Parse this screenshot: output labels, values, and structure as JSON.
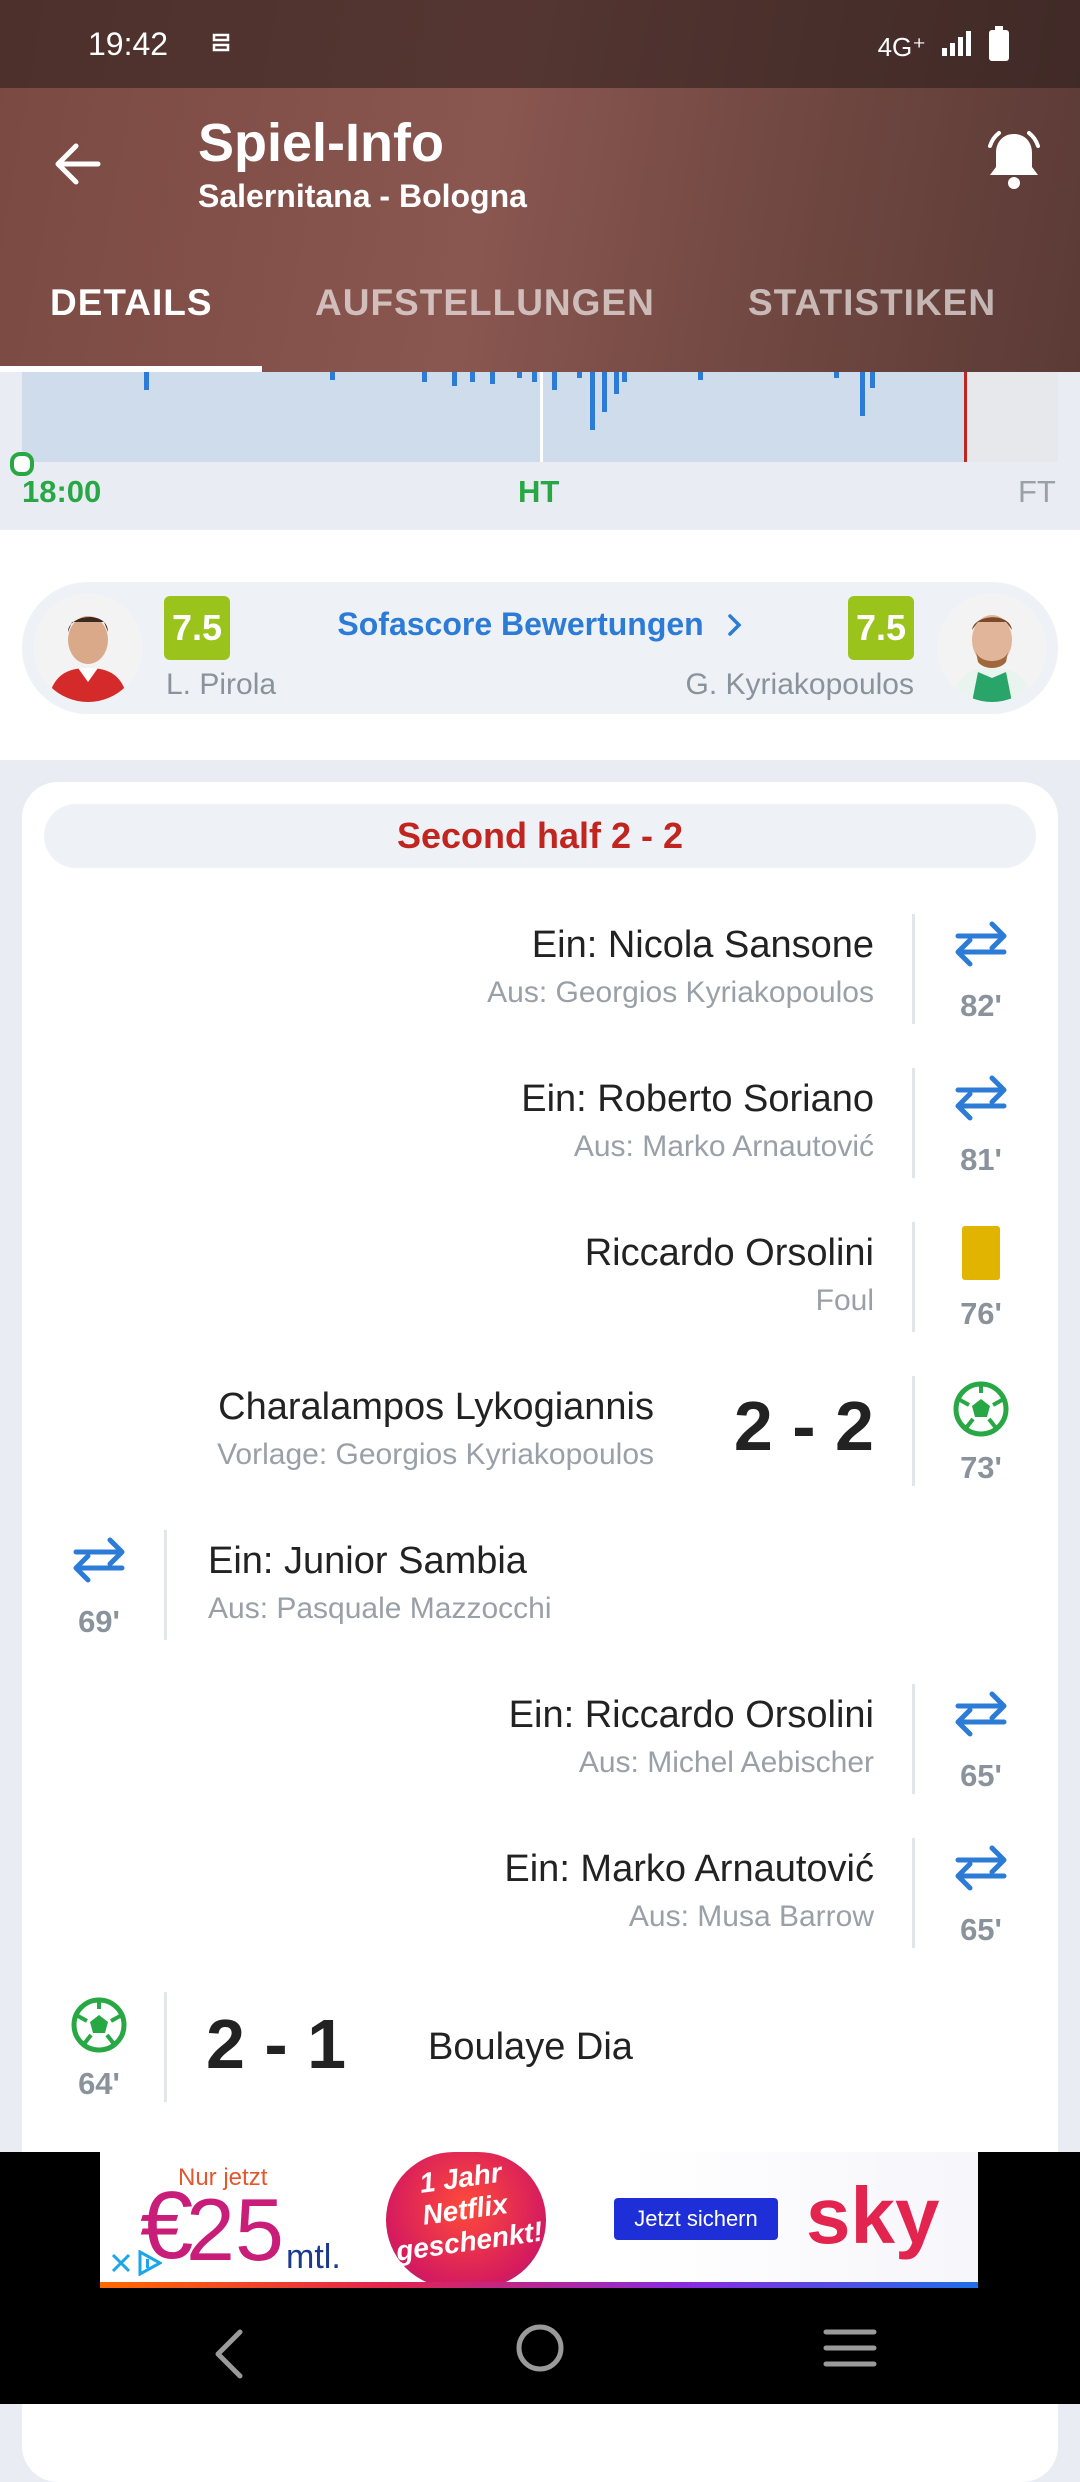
{
  "status": {
    "time": "19:42",
    "network": "4G⁺"
  },
  "header": {
    "title": "Spiel-Info",
    "subtitle": "Salernitana - Bologna"
  },
  "tabs": [
    {
      "label": "DETAILS",
      "active": true
    },
    {
      "label": "AUFSTELLUNGEN",
      "active": false
    },
    {
      "label": "STATISTIKEN",
      "active": false
    }
  ],
  "timeline": {
    "start": "18:00",
    "half": "HT",
    "end": "FT"
  },
  "ratings": {
    "link": "Sofascore Bewertungen",
    "left": {
      "name": "L. Pirola",
      "rating": "7.5"
    },
    "right": {
      "name": "G. Kyriakopoulos",
      "rating": "7.5"
    }
  },
  "section": {
    "title": "Second half 2 - 2"
  },
  "events": [
    {
      "side": "right",
      "type": "substitution",
      "main": "Ein: Nicola Sansone",
      "sub": "Aus: Georgios Kyriakopoulos",
      "minute": "82'"
    },
    {
      "side": "right",
      "type": "substitution",
      "main": "Ein: Roberto Soriano",
      "sub": "Aus: Marko Arnautović",
      "minute": "81'"
    },
    {
      "side": "right",
      "type": "yellow-card",
      "main": "Riccardo Orsolini",
      "sub": "Foul",
      "minute": "76'"
    },
    {
      "side": "right",
      "type": "goal",
      "main": "Charalampos Lykogiannis",
      "sub": "Vorlage: Georgios Kyriakopoulos",
      "score": "2 - 2",
      "minute": "73'"
    },
    {
      "side": "left",
      "type": "substitution",
      "main": "Ein: Junior Sambia",
      "sub": "Aus: Pasquale Mazzocchi",
      "minute": "69'"
    },
    {
      "side": "right",
      "type": "substitution",
      "main": "Ein: Riccardo Orsolini",
      "sub": "Aus: Michel Aebischer",
      "minute": "65'"
    },
    {
      "side": "right",
      "type": "substitution",
      "main": "Ein: Marko Arnautović",
      "sub": "Aus: Musa Barrow",
      "minute": "65'"
    },
    {
      "side": "left",
      "type": "goal",
      "main": "Boulaye Dia",
      "score": "2 - 1",
      "minute": "64'"
    }
  ],
  "ad": {
    "line1": "Nur jetzt",
    "price": "25",
    "unit": "mtl.",
    "promo": "1 Jahr Netflix geschenkt!",
    "cta": "Jetzt sichern",
    "brand": "sky"
  },
  "colors": {
    "accent": "#2c7bd6",
    "goal": "#27a844",
    "yellow": "#e0b400",
    "half": "#c0261f",
    "rating": "#9ac31c"
  }
}
